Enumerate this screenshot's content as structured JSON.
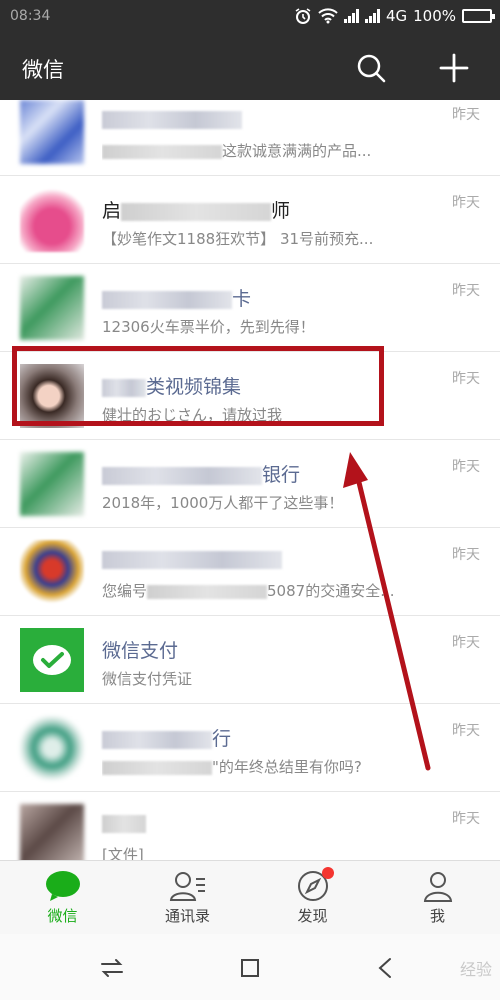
{
  "status_bar": {
    "time": "08:34",
    "network": "4G",
    "battery": "100%",
    "battery_level": 1.0
  },
  "header": {
    "title": "微信",
    "icons": [
      "search-icon",
      "plus-icon"
    ]
  },
  "chats": [
    {
      "name": "",
      "preview": "这款诚意满满的产品...",
      "time": "昨天"
    },
    {
      "name": "启",
      "name_tail": "师",
      "preview": "【妙笔作文1188狂欢节】 31号前预充...",
      "time": "昨天"
    },
    {
      "name": "",
      "name_tail": "卡",
      "preview": "12306火车票半价，先到先得！",
      "time": "昨天"
    },
    {
      "name": "类视频锦集",
      "preview": "健壮的おじさん，请放过我",
      "time": "昨天"
    },
    {
      "name": "",
      "name_tail": "银行",
      "preview": "2018年，1000万人都干了这些事！",
      "time": "昨天"
    },
    {
      "name": "",
      "preview_head": "您编号",
      "preview": "5087的交通安全...",
      "time": "昨天"
    },
    {
      "name": "微信支付",
      "preview": "微信支付凭证",
      "time": "昨天"
    },
    {
      "name": "",
      "name_tail": "行",
      "preview": "\"的年终总结里有你吗?",
      "time": "昨天"
    },
    {
      "name": "",
      "preview": "[文件]",
      "time": "昨天"
    }
  ],
  "tabs": [
    {
      "label": "微信",
      "icon": "chat-bubble-icon",
      "active": true
    },
    {
      "label": "通讯录",
      "icon": "contacts-icon",
      "active": false
    },
    {
      "label": "发现",
      "icon": "compass-icon",
      "active": false,
      "badge": true
    },
    {
      "label": "我",
      "icon": "person-icon",
      "active": false
    }
  ],
  "system_nav": {
    "icons": [
      "switch-apps-icon",
      "home-square-icon",
      "back-icon"
    ],
    "watermark": "经验"
  },
  "colors": {
    "header_bg": "#2e2e2e",
    "accent_green": "#1aad19",
    "highlight_red": "#b3121b",
    "name_blue": "#5b6a91"
  }
}
